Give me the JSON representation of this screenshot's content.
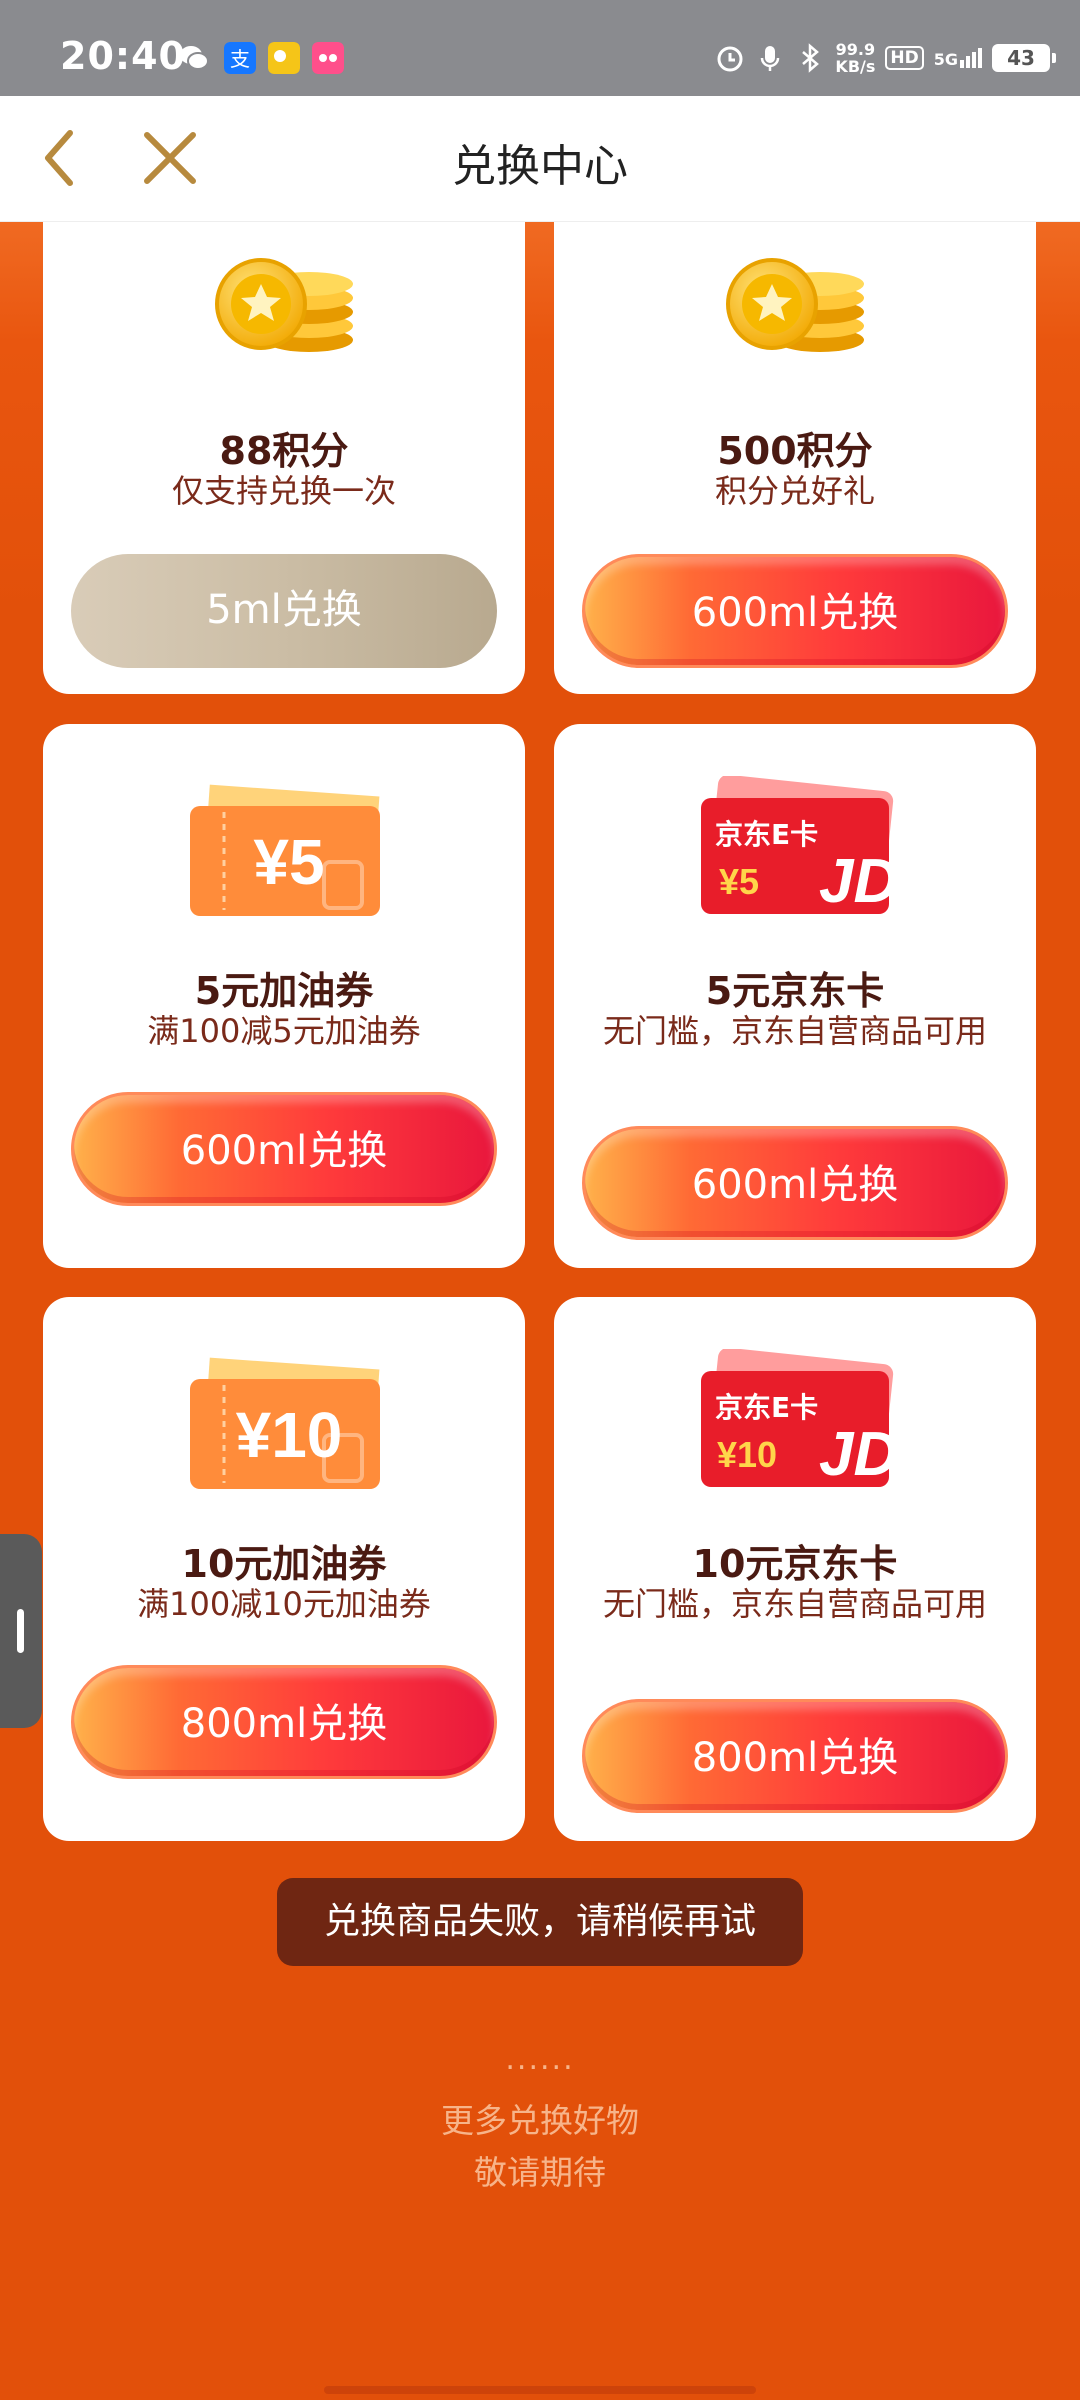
{
  "status_bar": {
    "time": "20:40",
    "speed_value": "99.9",
    "speed_unit": "KB/s",
    "hd": "HD",
    "network": "5G",
    "battery": "43",
    "icons": [
      "wechat-icon",
      "alipay-icon",
      "app-icon",
      "app-icon",
      "alarm-icon",
      "mic-icon",
      "bluetooth-icon",
      "signal-icon"
    ]
  },
  "nav": {
    "title": "兑换中心",
    "back_icon": "chevron-left-icon",
    "close_icon": "close-icon"
  },
  "cards": [
    {
      "title": "88积分",
      "desc": "仅支持兑换一次",
      "button": "5ml兑换",
      "image": "gold-coins",
      "button_state": "disabled"
    },
    {
      "title": "500积分",
      "desc": "积分兑好礼",
      "button": "600ml兑换",
      "image": "gold-coins",
      "button_state": "enabled"
    },
    {
      "title": "5元加油券",
      "desc": "满100减5元加油券",
      "button": "600ml兑换",
      "image": "fuel-coupon",
      "image_text": "¥5",
      "button_state": "enabled"
    },
    {
      "title": "5元京东卡",
      "desc": "无门槛，京东自营商品可用",
      "button": "600ml兑换",
      "image": "jd-card",
      "image_label": "京东E卡",
      "image_text": "¥5",
      "image_logo": "JD",
      "button_state": "enabled"
    },
    {
      "title": "10元加油券",
      "desc": "满100减10元加油券",
      "button": "800ml兑换",
      "image": "fuel-coupon",
      "image_text": "¥10",
      "button_state": "enabled"
    },
    {
      "title": "10元京东卡",
      "desc": "无门槛，京东自营商品可用",
      "button": "800ml兑换",
      "image": "jd-card",
      "image_label": "京东E卡",
      "image_text": "¥10",
      "image_logo": "JD",
      "button_state": "enabled"
    }
  ],
  "toast": "兑换商品失败，请稍候再试",
  "footer": {
    "dots": "......",
    "line1": "更多兑换好物",
    "line2": "敬请期待"
  },
  "colors": {
    "background": "#e2500a",
    "button_gradient_start": "#ffb14a",
    "button_gradient_end": "#e9173d",
    "disabled_button": "#cbbda5",
    "title_text": "#4a1a12"
  }
}
